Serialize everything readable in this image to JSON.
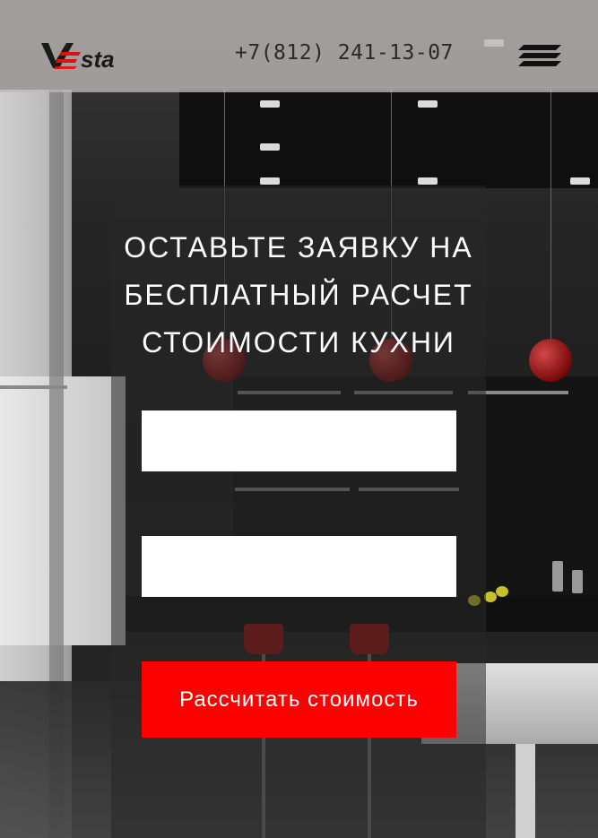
{
  "header": {
    "logo_text": "VESTA",
    "phone": "+7(812) 241-13-07",
    "menu_icon": "hamburger-menu-icon"
  },
  "form": {
    "title_lines": [
      "ОСТАВЬТЕ ЗАЯВКУ НА",
      "БЕСПЛАТНЫЙ РАСЧЕТ",
      "СТОИМОСТИ КУХНИ"
    ],
    "field1_value": "",
    "field2_value": "",
    "submit_label": "Рассчитать стоимость"
  },
  "colors": {
    "accent": "#fd0000",
    "header_bg": "#bebab8",
    "text_light": "#ffffff",
    "text_dark": "#2a2a2a"
  }
}
